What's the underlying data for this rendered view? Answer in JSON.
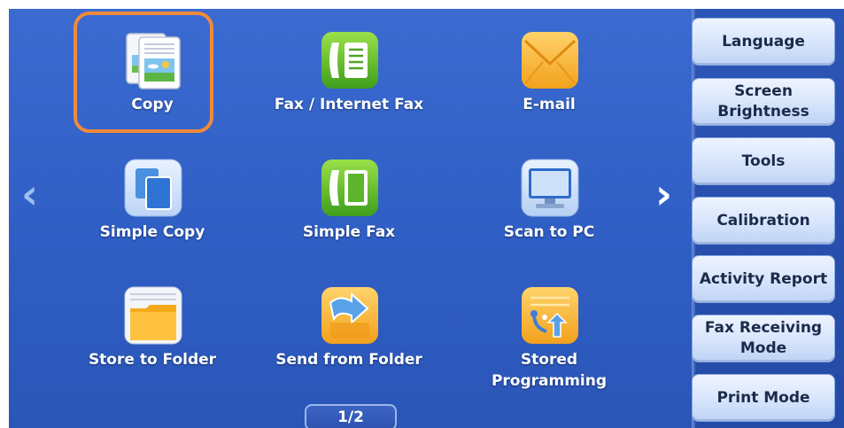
{
  "main": {
    "tiles": [
      {
        "label": "Copy",
        "icon": "copy-icon"
      },
      {
        "label": "Fax / Internet Fax",
        "icon": "fax-icon"
      },
      {
        "label": "E-mail",
        "icon": "email-icon"
      },
      {
        "label": "Simple Copy",
        "icon": "simple-copy-icon"
      },
      {
        "label": "Simple Fax",
        "icon": "simple-fax-icon"
      },
      {
        "label": "Scan to PC",
        "icon": "monitor-icon"
      },
      {
        "label": "Store to Folder",
        "icon": "folder-icon"
      },
      {
        "label": "Send from Folder",
        "icon": "send-folder-icon"
      },
      {
        "label": "Stored\nProgramming",
        "icon": "stored-programming-icon"
      }
    ],
    "page_indicator": "1/2",
    "prev_arrow": "‹",
    "next_arrow": "›",
    "selected": "Copy"
  },
  "sidebar": {
    "buttons": [
      {
        "label": "Language"
      },
      {
        "label": "Screen\nBrightness"
      },
      {
        "label": "Tools"
      },
      {
        "label": "Calibration"
      },
      {
        "label": "Activity Report"
      },
      {
        "label": "Fax Receiving\nMode"
      },
      {
        "label": "Print Mode"
      }
    ]
  },
  "colors": {
    "background": "#3b6bd0",
    "highlight": "#f08a3c",
    "button_face": "#d6e4fb"
  }
}
